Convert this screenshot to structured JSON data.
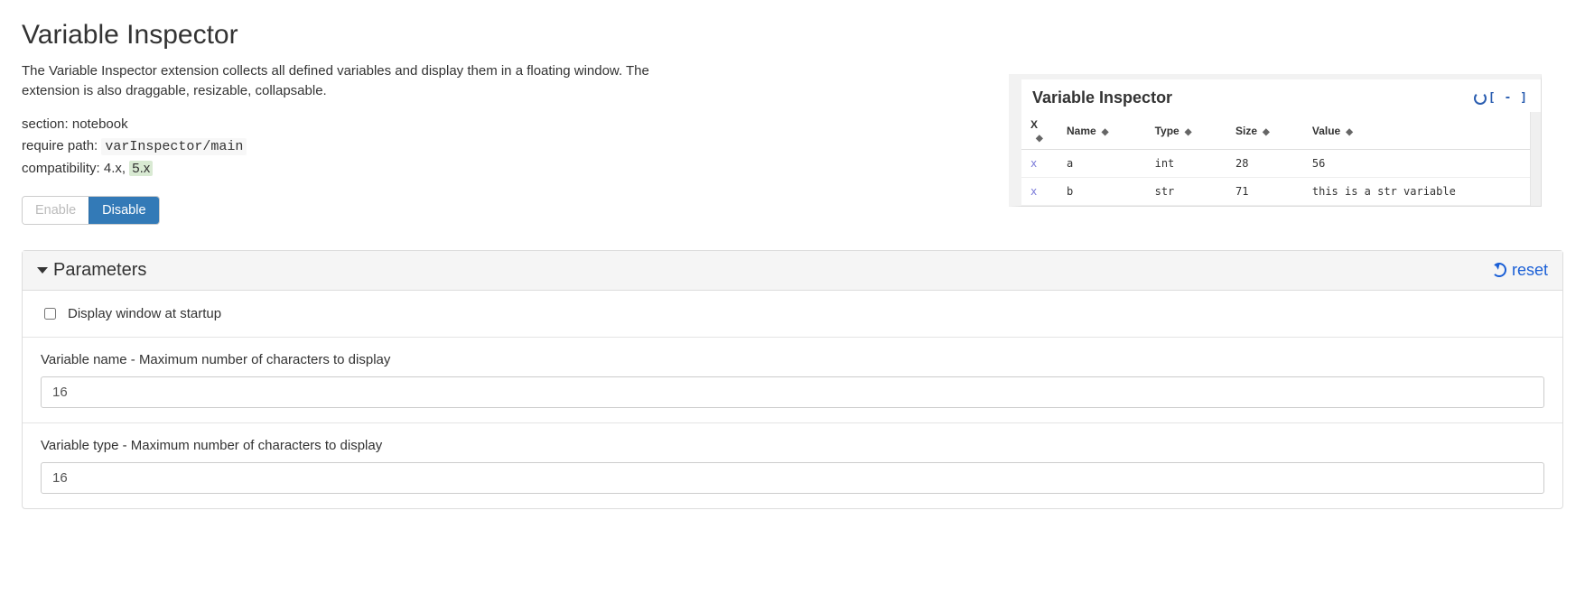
{
  "header": {
    "title": "Variable Inspector",
    "description": "The Variable Inspector extension collects all defined variables and display them in a floating window. The extension is also draggable, resizable, collapsable."
  },
  "meta": {
    "section_label": "section:",
    "section_value": "notebook",
    "require_label": "require path:",
    "require_value": "varInspector/main",
    "compat_label": "compatibility:",
    "compat_prev": "4.x,",
    "compat_current": "5.x"
  },
  "buttons": {
    "enable": "Enable",
    "disable": "Disable"
  },
  "screenshot": {
    "title": "Variable Inspector",
    "collapse": "[ - ]",
    "columns": {
      "x": "X",
      "name": "Name",
      "type": "Type",
      "size": "Size",
      "value": "Value"
    },
    "rows": [
      {
        "x": "x",
        "name": "a",
        "type": "int",
        "size": "28",
        "value": "56"
      },
      {
        "x": "x",
        "name": "b",
        "type": "str",
        "size": "71",
        "value": "this is a str variable"
      }
    ]
  },
  "parameters": {
    "heading": "Parameters",
    "reset": "reset",
    "startup_checkbox_label": "Display window at startup",
    "startup_checked": false,
    "var_name_label": "Variable name - Maximum number of characters to display",
    "var_name_value": "16",
    "var_type_label": "Variable type - Maximum number of characters to display",
    "var_type_value": "16"
  }
}
